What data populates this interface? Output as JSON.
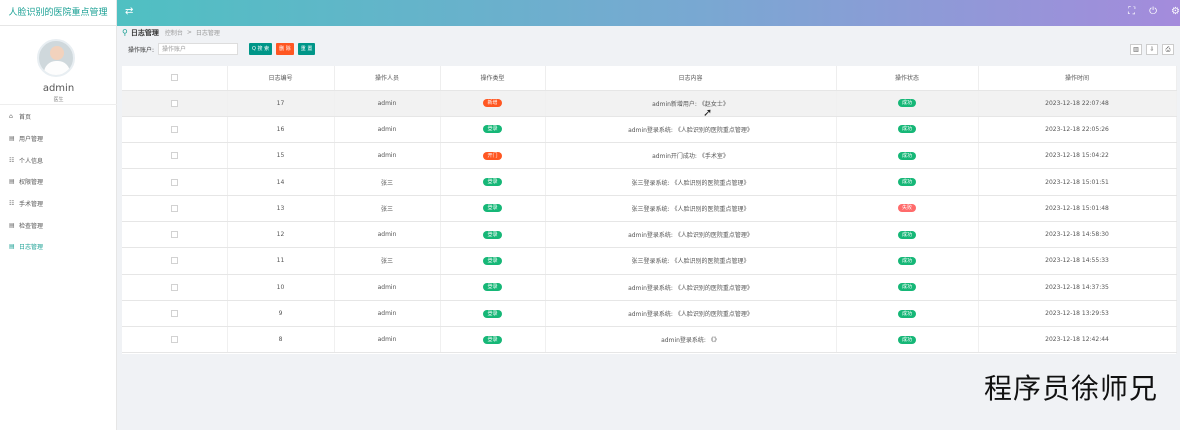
{
  "app": {
    "title": "人脸识别的医院重点管理"
  },
  "topbar": {
    "icons": [
      "expand-icon",
      "fullscreen-icon",
      "power-icon",
      "settings-icon"
    ]
  },
  "user": {
    "name": "admin",
    "role": "医生"
  },
  "menu": [
    {
      "label": "首页",
      "icon": "home-icon",
      "glyph": "⌂"
    },
    {
      "label": "用户管理",
      "icon": "calendar-icon",
      "glyph": "▤"
    },
    {
      "label": "个人信息",
      "icon": "users-icon",
      "glyph": "☷"
    },
    {
      "label": "权限管理",
      "icon": "calendar-icon",
      "glyph": "▤"
    },
    {
      "label": "手术管理",
      "icon": "users-icon",
      "glyph": "☷"
    },
    {
      "label": "检查管理",
      "icon": "calendar-icon",
      "glyph": "▤"
    },
    {
      "label": "日志管理",
      "icon": "list-icon",
      "glyph": "▤"
    }
  ],
  "breadcrumb": {
    "title": "日志管理",
    "home": "控制台",
    "sep": ">",
    "current": "日志管理"
  },
  "search": {
    "label": "操作账户:",
    "placeholder": "操作账户",
    "search_btn": "Q 搜 索",
    "delete_btn": "删 除",
    "reset_btn": "重 置"
  },
  "table": {
    "columns": [
      "日志编号",
      "操作人员",
      "操作类型",
      "日志内容",
      "操作状态",
      "操作时间"
    ],
    "rows": [
      {
        "id": "17",
        "user": "admin",
        "type": "新增",
        "type_color": "red",
        "content": "admin新增用户: 《赵女士》",
        "status": "成功",
        "status_color": "green",
        "time": "2023-12-18 22:07:48"
      },
      {
        "id": "16",
        "user": "admin",
        "type": "登录",
        "type_color": "green",
        "content": "admin登录系统: 《人脸识别的医院重点管理》",
        "status": "成功",
        "status_color": "green",
        "time": "2023-12-18 22:05:26"
      },
      {
        "id": "15",
        "user": "admin",
        "type": "开门",
        "type_color": "red",
        "content": "admin开门成功: 《手术室》",
        "status": "成功",
        "status_color": "green",
        "time": "2023-12-18 15:04:22"
      },
      {
        "id": "14",
        "user": "张三",
        "type": "登录",
        "type_color": "green",
        "content": "张三登录系统: 《人脸识别的医院重点管理》",
        "status": "成功",
        "status_color": "green",
        "time": "2023-12-18 15:01:51"
      },
      {
        "id": "13",
        "user": "张三",
        "type": "登录",
        "type_color": "green",
        "content": "张三登录系统: 《人脸识别的医院重点管理》",
        "status": "失败",
        "status_color": "pink",
        "time": "2023-12-18 15:01:48"
      },
      {
        "id": "12",
        "user": "admin",
        "type": "登录",
        "type_color": "green",
        "content": "admin登录系统: 《人脸识别的医院重点管理》",
        "status": "成功",
        "status_color": "green",
        "time": "2023-12-18 14:58:30"
      },
      {
        "id": "11",
        "user": "张三",
        "type": "登录",
        "type_color": "green",
        "content": "张三登录系统: 《人脸识别的医院重点管理》",
        "status": "成功",
        "status_color": "green",
        "time": "2023-12-18 14:55:33"
      },
      {
        "id": "10",
        "user": "admin",
        "type": "登录",
        "type_color": "green",
        "content": "admin登录系统: 《人脸识别的医院重点管理》",
        "status": "成功",
        "status_color": "green",
        "time": "2023-12-18 14:37:35"
      },
      {
        "id": "9",
        "user": "admin",
        "type": "登录",
        "type_color": "green",
        "content": "admin登录系统: 《人脸识别的医院重点管理》",
        "status": "成功",
        "status_color": "green",
        "time": "2023-12-18 13:29:53"
      },
      {
        "id": "8",
        "user": "admin",
        "type": "登录",
        "type_color": "green",
        "content": "admin登录系统: 《》",
        "status": "成功",
        "status_color": "green",
        "time": "2023-12-18 12:42:44"
      }
    ]
  },
  "watermark": "程序员徐师兄"
}
